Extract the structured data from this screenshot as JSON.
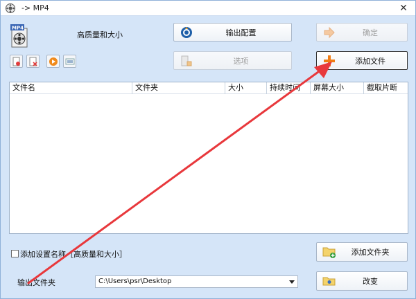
{
  "window": {
    "title": "-> MP4"
  },
  "profile": {
    "label": "高质量和大小"
  },
  "buttons": {
    "output_config": "输出配置",
    "ok": "确定",
    "options": "选项",
    "add_file": "添加文件",
    "add_folder": "添加文件夹",
    "change": "改变"
  },
  "table": {
    "columns": [
      "文件名",
      "文件夹",
      "大小",
      "持续时间",
      "屏幕大小",
      "截取片断"
    ]
  },
  "checkbox": {
    "label": "添加设置名称［高质量和大小］",
    "checked": false
  },
  "output_folder": {
    "label": "输出文件夹",
    "path": "C:\\Users\\psr\\Desktop"
  },
  "colors": {
    "accent_arrow": "#e8383c",
    "window_bg": "#d5e5f8"
  }
}
